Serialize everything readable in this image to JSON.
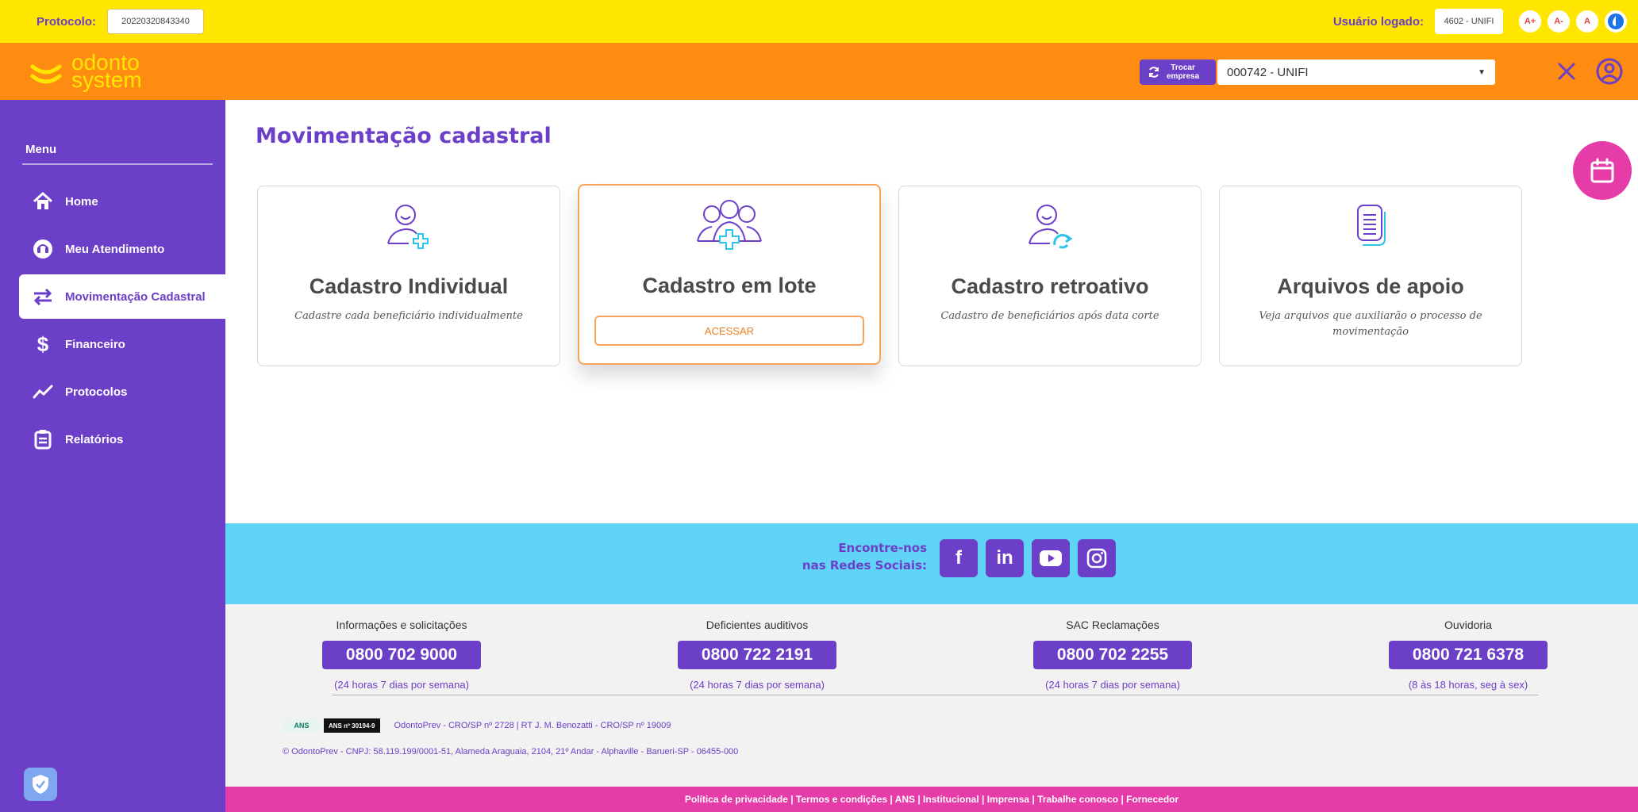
{
  "topbar": {
    "protocol_label": "Protocolo:",
    "protocol_value": "20220320843340",
    "user_label": "Usuário logado:",
    "user_value": "4602 - UNIFI",
    "font_increase": "A+",
    "font_decrease": "A-",
    "font_reset": "A"
  },
  "header": {
    "logo_line1": "odonto",
    "logo_line2": "system",
    "swap_line1": "Trocar",
    "swap_line2": "empresa",
    "company_value": "000742 - UNIFI"
  },
  "sidebar": {
    "title": "Menu",
    "items": [
      {
        "label": "Home",
        "icon": "home-icon"
      },
      {
        "label": "Meu Atendimento",
        "icon": "headset-icon"
      },
      {
        "label": "Movimentação Cadastral",
        "icon": "swap-arrows-icon",
        "active": true
      },
      {
        "label": "Financeiro",
        "icon": "dollar-icon"
      },
      {
        "label": "Protocolos",
        "icon": "trend-line-icon"
      },
      {
        "label": "Relatórios",
        "icon": "report-icon"
      }
    ]
  },
  "main": {
    "title": "Movimentação cadastral",
    "cards": [
      {
        "title": "Cadastro Individual",
        "description": "Cadastre cada beneficiário individualmente"
      },
      {
        "title": "Cadastro em lote",
        "action": "ACESSAR"
      },
      {
        "title": "Cadastro retroativo",
        "description": "Cadastro de beneficiários após data corte"
      },
      {
        "title": "Arquivos de apoio",
        "description": "Veja arquivos que auxiliarão o processo de movimentação"
      }
    ]
  },
  "social": {
    "line1": "Encontre-nos",
    "line2": "nas Redes Sociais:",
    "facebook": "f",
    "linkedin": "in"
  },
  "contacts": [
    {
      "label": "Informações e solicitações",
      "phone": "0800 702 9000",
      "hours": "(24 horas 7 dias por semana)"
    },
    {
      "label": "Deficientes auditivos",
      "phone": "0800 722 2191",
      "hours": "(24 horas 7 dias por semana)"
    },
    {
      "label": "SAC Reclamações",
      "phone": "0800 702 2255",
      "hours": "(24 horas 7 dias por semana)"
    },
    {
      "label": "Ouvidoria",
      "phone": "0800 721 6378",
      "hours": "(8 às 18 horas, seg à sex)"
    }
  ],
  "legal": {
    "ans_logo": "ANS",
    "ans_registration": "ANS nº 30194-9",
    "line1": "OdontoPrev - CRO/SP nº 2728 | RT J. M. Benozatti - CRO/SP nº 19009",
    "line2": "© OdontoPrev - CNPJ: 58.119.199/0001-51, Alameda Araguaia, 2104, 21º Andar - Alphaville - Barueri-SP - 06455-000"
  },
  "policy_bar": "Política de privacidade | Termos e condições | ANS | Institucional | Imprensa | Trabalhe conosco | Fornecedor",
  "colors": {
    "purple": "#6b3fc8",
    "yellow": "#ffe600",
    "orange": "#ff8c12",
    "magenta": "#e63ca9",
    "cyan": "#5fd4f7"
  }
}
